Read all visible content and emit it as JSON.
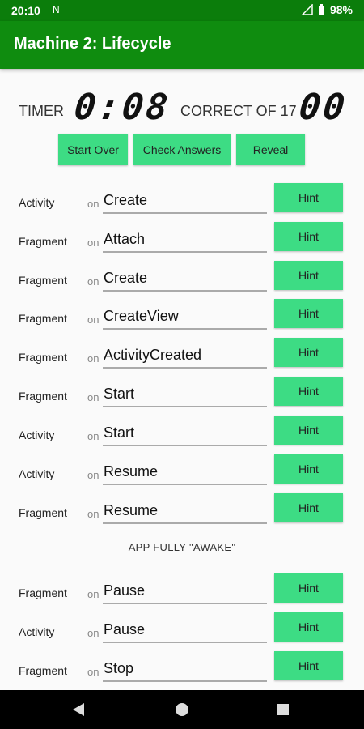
{
  "status": {
    "time": "20:10",
    "notif_icon": "N",
    "battery": "98%"
  },
  "app": {
    "title": "Machine 2: Lifecycle"
  },
  "timer": {
    "label": "TIMER",
    "value": "0:08",
    "correct_label": "CORRECT OF 17",
    "correct_value": "00"
  },
  "buttons": {
    "start_over": "Start Over",
    "check_answers": "Check Answers",
    "reveal": "Reveal"
  },
  "on_prefix": "on",
  "hint_label": "Hint",
  "rows": [
    {
      "component": "Activity",
      "method": "Create"
    },
    {
      "component": "Fragment",
      "method": "Attach"
    },
    {
      "component": "Fragment",
      "method": "Create"
    },
    {
      "component": "Fragment",
      "method": "CreateView"
    },
    {
      "component": "Fragment",
      "method": "ActivityCreated"
    },
    {
      "component": "Fragment",
      "method": "Start"
    },
    {
      "component": "Activity",
      "method": "Start"
    },
    {
      "component": "Activity",
      "method": "Resume"
    },
    {
      "component": "Fragment",
      "method": "Resume"
    },
    {
      "component": "Fragment",
      "method": "Pause"
    },
    {
      "component": "Activity",
      "method": "Pause"
    },
    {
      "component": "Fragment",
      "method": "Stop"
    }
  ],
  "divider": "APP FULLY \"AWAKE\""
}
